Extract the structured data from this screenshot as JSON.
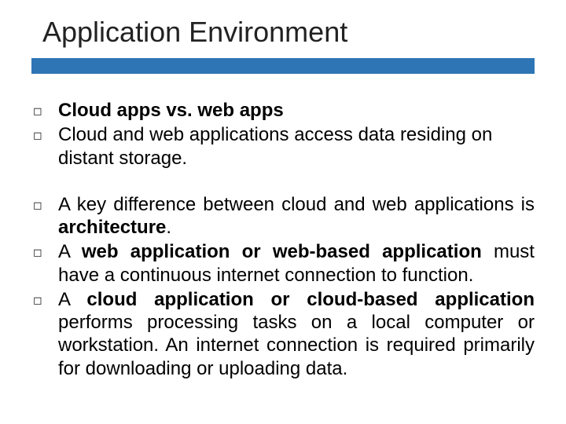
{
  "title": "Application Environment",
  "bullets": {
    "g1": {
      "b1_bold": "Cloud apps vs. web apps",
      "b2": "Cloud and web applications access data residing on distant storage."
    },
    "g2": {
      "b3_pre": "A key difference between cloud and web applications is ",
      "b3_bold": "architecture",
      "b3_post": ".",
      "b4_pre": "A ",
      "b4_bold": "web application or web-based application",
      "b4_post": " must have a continuous internet connection to function.",
      "b5_pre": "A ",
      "b5_bold": "cloud application or cloud-based application",
      "b5_post": " performs processing tasks on a local computer or workstation. An internet connection is required primarily for downloading or uploading data."
    }
  }
}
